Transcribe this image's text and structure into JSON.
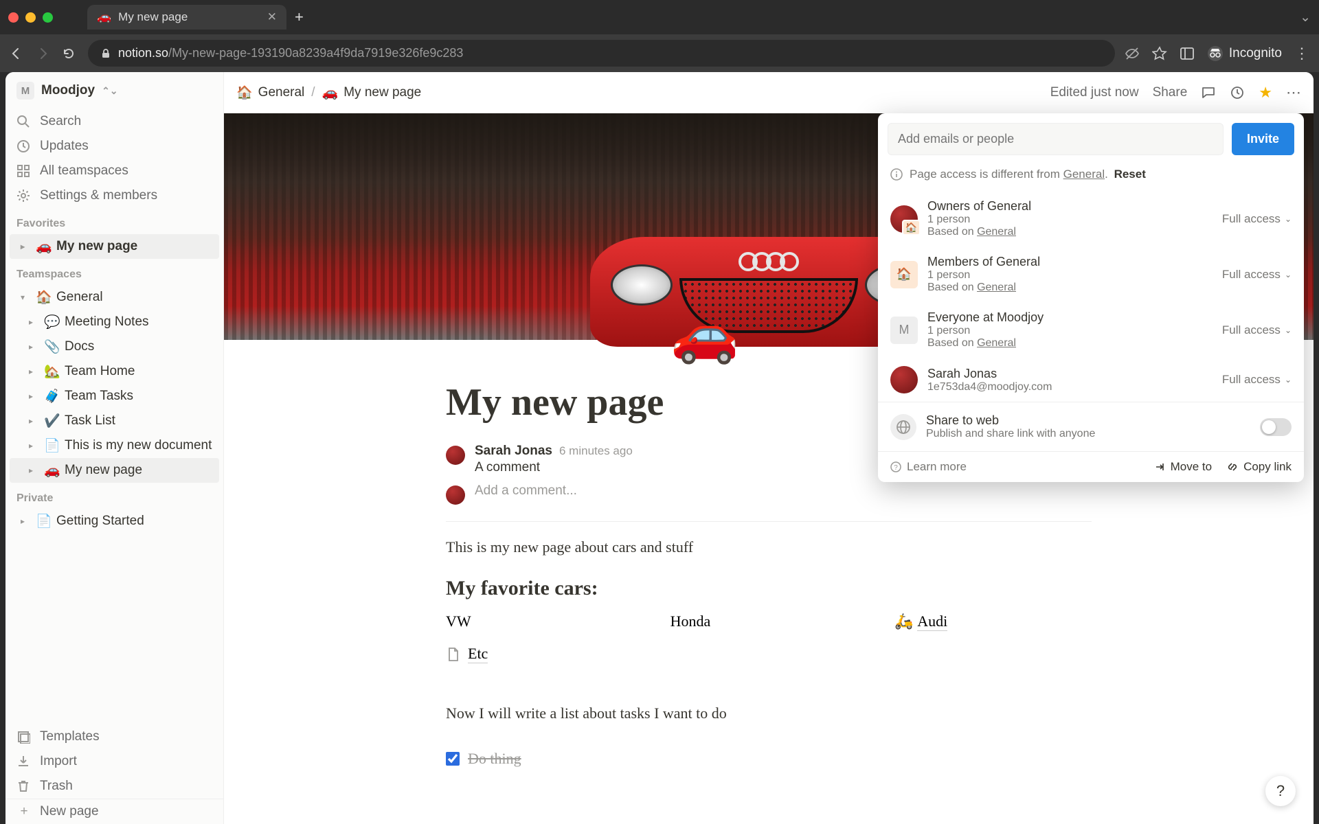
{
  "browser": {
    "tab_title": "My new page",
    "tab_emoji": "🚗",
    "url_host": "notion.so",
    "url_path": "/My-new-page-193190a8239a4f9da7919e326fe9c283",
    "incognito_label": "Incognito"
  },
  "workspace": {
    "name": "Moodjoy",
    "initial": "M"
  },
  "sidebar_top": [
    {
      "icon": "search",
      "label": "Search"
    },
    {
      "icon": "clock",
      "label": "Updates"
    },
    {
      "icon": "grid",
      "label": "All teamspaces"
    },
    {
      "icon": "gear",
      "label": "Settings & members"
    }
  ],
  "favorites_label": "Favorites",
  "favorites": [
    {
      "emoji": "🚗",
      "label": "My new page",
      "selected": true
    }
  ],
  "teamspaces_label": "Teamspaces",
  "teamspaces": {
    "root": {
      "emoji": "🏠",
      "label": "General"
    },
    "children": [
      {
        "emoji": "💬",
        "label": "Meeting Notes"
      },
      {
        "emoji": "📎",
        "label": "Docs"
      },
      {
        "emoji": "🏡",
        "label": "Team Home"
      },
      {
        "emoji": "🧳",
        "label": "Team Tasks"
      },
      {
        "emoji": "✔️",
        "label": "Task List"
      },
      {
        "emoji": "📄",
        "label": "This is my new document"
      },
      {
        "emoji": "🚗",
        "label": "My new page",
        "active": true
      }
    ]
  },
  "private_label": "Private",
  "private": [
    {
      "emoji": "📄",
      "label": "Getting Started"
    }
  ],
  "sidebar_bottom": [
    {
      "icon": "templates",
      "label": "Templates"
    },
    {
      "icon": "import",
      "label": "Import"
    },
    {
      "icon": "trash",
      "label": "Trash"
    }
  ],
  "new_page_label": "New page",
  "breadcrumb": [
    {
      "emoji": "🏠",
      "label": "General"
    },
    {
      "emoji": "🚗",
      "label": "My new page"
    }
  ],
  "topbar": {
    "edited": "Edited just now",
    "share": "Share"
  },
  "page": {
    "icon": "🚗",
    "title": "My new page"
  },
  "comments": {
    "author": "Sarah Jonas",
    "time": "6 minutes ago",
    "text": "A comment",
    "add_placeholder": "Add a comment..."
  },
  "body": {
    "intro": "This is my new page about cars and stuff",
    "h2": "My favorite cars:",
    "cols": [
      "VW",
      "Honda",
      "Audi"
    ],
    "audi_emoji": "🛵",
    "etc_label": "Etc",
    "tasks_intro": "Now I will write a list about tasks I want to do",
    "todo1": "Do thing"
  },
  "share": {
    "input_placeholder": "Add emails or people",
    "invite": "Invite",
    "notice_pre": "Page access is different from ",
    "notice_link": "General",
    "notice_post": ".",
    "reset": "Reset",
    "access_label": "Full access",
    "rows": [
      {
        "avatar": "red-badge",
        "title": "Owners of General",
        "sub1": "1 person",
        "sub2_pre": "Based on ",
        "sub2_link": "General"
      },
      {
        "avatar": "orange",
        "icon": "🏠",
        "title": "Members of General",
        "sub1": "1 person",
        "sub2_pre": "Based on ",
        "sub2_link": "General"
      },
      {
        "avatar": "gray",
        "icon": "M",
        "title": "Everyone at Moodjoy",
        "sub1": "1 person",
        "sub2_pre": "Based on ",
        "sub2_link": "General"
      },
      {
        "avatar": "red",
        "title": "Sarah Jonas",
        "sub1": "1e753da4@moodjoy.com"
      }
    ],
    "web_title": "Share to web",
    "web_sub": "Publish and share link with anyone",
    "learn_more": "Learn more",
    "move_to": "Move to",
    "copy_link": "Copy link"
  },
  "help_label": "?"
}
